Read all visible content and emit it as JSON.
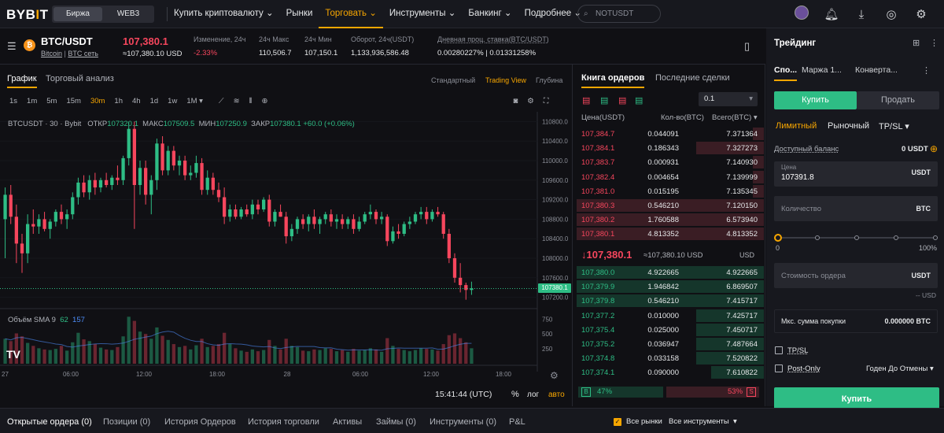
{
  "nav": {
    "logo_main": "BYB",
    "logo_accent": "I",
    "logo_end": "T",
    "seg_exchange": "Биржа",
    "seg_web3": "WEB3",
    "links": [
      "Купить криптовалюту",
      "Рынки",
      "Торговать",
      "Инструменты",
      "Банкинг",
      "Подробнее"
    ],
    "search_placeholder": "NOTUSDT"
  },
  "ticker": {
    "pair": "BTC/USDT",
    "sub_name": "Bitcoin",
    "sub_net": "BTC сеть",
    "price": "107,380.1",
    "price_usd": "≈107,380.10 USD",
    "change_label": "Изменение, 24ч",
    "change_value": "-2.33%",
    "high_label": "24ч Макс",
    "high_value": "110,506.7",
    "low_label": "24ч Мин",
    "low_value": "107,150.1",
    "turnover_label": "Оборот, 24ч(USDT)",
    "turnover_value": "1,133,936,586.48",
    "funding_label": "Дневная проц. ставка(BTC/USDT)",
    "funding_value": "0.00280227% | 0.01331258%"
  },
  "chart_tabs": {
    "chart": "График",
    "analysis": "Торговый анализ",
    "standard": "Стандартный",
    "tradingview": "Trading View",
    "depth": "Глубина"
  },
  "timeframes": [
    "1s",
    "1m",
    "5m",
    "15m",
    "30m",
    "1h",
    "4h",
    "1d",
    "1w",
    "1M ▾"
  ],
  "chart_legend": {
    "symbol": "BTCUSDT · 30 · Bybit",
    "open_label": "ОТКР",
    "open": "107320.1",
    "high_label": "МАКС",
    "high": "107509.5",
    "low_label": "МИН",
    "low": "107250.9",
    "close_label": "ЗАКР",
    "close": "107380.1",
    "change": "+60.0 (+0.06%)",
    "volume": "Объём SMA 9",
    "vol1": "62",
    "vol2": "157",
    "price_tag": "107380.1",
    "clock": "15:41:44 (UTC)",
    "pct": "%",
    "log": "лог",
    "auto": "авто"
  },
  "chart_data": {
    "type": "candlestick",
    "interval": "30m",
    "y_ticks": [
      110800,
      110400,
      110000,
      109600,
      109200,
      108800,
      108400,
      108000,
      107600,
      107200
    ],
    "vol_ticks": [
      750,
      500,
      250
    ],
    "x_ticks": [
      "06:00",
      "12:00",
      "18:00",
      "28",
      "06:00",
      "12:00",
      "18:00"
    ],
    "x_edge": "27",
    "candles": [
      [
        108800,
        109450,
        108000,
        109300,
        420
      ],
      [
        109300,
        109500,
        108700,
        108850,
        380
      ],
      [
        108850,
        109100,
        107900,
        108300,
        510
      ],
      [
        108300,
        108500,
        107700,
        108100,
        460
      ],
      [
        108100,
        108900,
        107900,
        108700,
        350
      ],
      [
        108700,
        109000,
        108500,
        108650,
        300
      ],
      [
        108650,
        108900,
        108500,
        108800,
        260
      ],
      [
        108800,
        108950,
        108550,
        108600,
        240
      ],
      [
        108600,
        108800,
        108400,
        108750,
        230
      ],
      [
        108750,
        109000,
        108650,
        108950,
        250
      ],
      [
        108950,
        109100,
        108700,
        108800,
        300
      ],
      [
        108800,
        109000,
        108600,
        108900,
        220
      ],
      [
        108900,
        109350,
        108800,
        109250,
        360
      ],
      [
        109250,
        109650,
        109100,
        109550,
        520
      ],
      [
        109550,
        109700,
        109250,
        109350,
        410
      ],
      [
        109350,
        109700,
        109200,
        109600,
        380
      ],
      [
        109600,
        109750,
        109300,
        109450,
        330
      ],
      [
        109450,
        109650,
        109350,
        109600,
        270
      ],
      [
        109600,
        109750,
        109450,
        109500,
        240
      ],
      [
        109500,
        109700,
        109400,
        109650,
        230
      ],
      [
        109650,
        109900,
        109500,
        109600,
        280
      ],
      [
        109600,
        110100,
        109500,
        110050,
        460
      ],
      [
        110050,
        110800,
        109900,
        110650,
        790
      ],
      [
        110650,
        110800,
        108600,
        109500,
        720
      ],
      [
        109500,
        110000,
        109300,
        109850,
        540
      ],
      [
        109850,
        110000,
        109100,
        109300,
        500
      ],
      [
        109300,
        109700,
        108900,
        109600,
        420
      ],
      [
        109600,
        110450,
        109400,
        110350,
        610
      ],
      [
        110350,
        110500,
        109700,
        109800,
        470
      ],
      [
        109800,
        110300,
        109700,
        110200,
        400
      ],
      [
        110200,
        110300,
        109800,
        109900,
        330
      ],
      [
        109900,
        110100,
        109700,
        110000,
        280
      ],
      [
        110000,
        110100,
        109600,
        109700,
        300
      ],
      [
        109700,
        109900,
        109600,
        109750,
        240
      ],
      [
        109750,
        110100,
        109650,
        109950,
        310
      ],
      [
        109950,
        110050,
        109300,
        109400,
        420
      ],
      [
        109400,
        109800,
        109300,
        109650,
        280
      ],
      [
        109650,
        109750,
        109300,
        109400,
        300
      ],
      [
        109400,
        109550,
        109150,
        109250,
        330
      ],
      [
        109250,
        109450,
        108700,
        108850,
        520
      ],
      [
        108850,
        109100,
        108750,
        109000,
        330
      ],
      [
        109000,
        109100,
        108800,
        108850,
        260
      ],
      [
        108850,
        109050,
        108800,
        109000,
        220
      ],
      [
        109000,
        109100,
        108850,
        108900,
        200
      ],
      [
        108900,
        109200,
        108800,
        109100,
        240
      ],
      [
        109100,
        109200,
        108900,
        109000,
        210
      ],
      [
        109000,
        109250,
        108950,
        109200,
        230
      ],
      [
        109200,
        109300,
        108650,
        108750,
        400
      ],
      [
        108750,
        109000,
        108650,
        108950,
        300
      ],
      [
        108950,
        109100,
        108850,
        108850,
        240
      ],
      [
        108850,
        108950,
        108300,
        108450,
        420
      ],
      [
        108450,
        108700,
        108350,
        108600,
        300
      ],
      [
        108600,
        108850,
        108500,
        108800,
        280
      ],
      [
        108800,
        108900,
        108600,
        108700,
        220
      ],
      [
        108700,
        108900,
        108550,
        108850,
        210
      ],
      [
        108850,
        109000,
        108600,
        108700,
        240
      ],
      [
        108700,
        108850,
        108500,
        108800,
        230
      ],
      [
        108800,
        108950,
        108700,
        108900,
        260
      ],
      [
        108900,
        109000,
        108650,
        108750,
        250
      ],
      [
        108750,
        108900,
        108600,
        108800,
        210
      ],
      [
        108800,
        108900,
        108600,
        108700,
        230
      ],
      [
        108700,
        108850,
        108600,
        108800,
        200
      ],
      [
        108800,
        108900,
        108500,
        108600,
        250
      ],
      [
        108600,
        108850,
        108550,
        108750,
        220
      ],
      [
        108750,
        108950,
        108700,
        108900,
        230
      ],
      [
        108900,
        109100,
        108800,
        108950,
        260
      ],
      [
        108950,
        109000,
        108700,
        108800,
        240
      ],
      [
        108800,
        108950,
        108700,
        108850,
        200
      ],
      [
        108850,
        108900,
        108250,
        108350,
        430
      ],
      [
        108350,
        108650,
        108300,
        108550,
        300
      ],
      [
        108550,
        108700,
        108400,
        108500,
        250
      ],
      [
        108500,
        108750,
        108450,
        108700,
        230
      ],
      [
        108700,
        108850,
        108600,
        108750,
        210
      ],
      [
        108750,
        108950,
        108700,
        108900,
        230
      ],
      [
        108900,
        109050,
        108800,
        108950,
        260
      ],
      [
        108950,
        109050,
        108700,
        108800,
        250
      ],
      [
        108800,
        109000,
        108750,
        108950,
        240
      ],
      [
        108950,
        109050,
        108850,
        108900,
        220
      ],
      [
        108900,
        108950,
        108400,
        108500,
        330
      ],
      [
        108500,
        108600,
        107900,
        108000,
        480
      ],
      [
        108000,
        108100,
        107500,
        107600,
        510
      ],
      [
        107600,
        107900,
        107300,
        107450,
        430
      ],
      [
        107450,
        107500,
        107150,
        107350,
        360
      ],
      [
        107350,
        107520,
        107250,
        107380,
        260
      ]
    ]
  },
  "orderbook": {
    "tab_book": "Книга ордеров",
    "tab_trades": "Последние сделки",
    "precision": "0.1",
    "col_price": "Цена(USDT)",
    "col_qty": "Кол-во(BTC)",
    "col_total": "Всего(BTC)",
    "asks": [
      {
        "price": "107,384.7",
        "qty": "0.044091",
        "total": "7.371364",
        "depth": 0.06
      },
      {
        "price": "107,384.1",
        "qty": "0.186343",
        "total": "7.327273",
        "depth": 0.36
      },
      {
        "price": "107,383.7",
        "qty": "0.000931",
        "total": "7.140930",
        "depth": 0.06
      },
      {
        "price": "107,382.4",
        "qty": "0.004654",
        "total": "7.139999",
        "depth": 0.06
      },
      {
        "price": "107,381.0",
        "qty": "0.015195",
        "total": "7.135345",
        "depth": 0.06
      },
      {
        "price": "107,380.3",
        "qty": "0.546210",
        "total": "7.120150",
        "depth": 1.0
      },
      {
        "price": "107,380.2",
        "qty": "1.760588",
        "total": "6.573940",
        "depth": 1.0
      },
      {
        "price": "107,380.1",
        "qty": "4.813352",
        "total": "4.813352",
        "depth": 1.0
      }
    ],
    "mid_price": "↓107,380.1",
    "mid_usd": "≈107,380.10 USD",
    "bids": [
      {
        "price": "107,380.0",
        "qty": "4.922665",
        "total": "4.922665",
        "depth": 1.0
      },
      {
        "price": "107,379.9",
        "qty": "1.946842",
        "total": "6.869507",
        "depth": 1.0
      },
      {
        "price": "107,379.8",
        "qty": "0.546210",
        "total": "7.415717",
        "depth": 1.0
      },
      {
        "price": "107,377.2",
        "qty": "0.010000",
        "total": "7.425717",
        "depth": 0.36
      },
      {
        "price": "107,375.4",
        "qty": "0.025000",
        "total": "7.450717",
        "depth": 0.36
      },
      {
        "price": "107,375.2",
        "qty": "0.036947",
        "total": "7.487664",
        "depth": 0.36
      },
      {
        "price": "107,374.8",
        "qty": "0.033158",
        "total": "7.520822",
        "depth": 0.36
      },
      {
        "price": "107,374.1",
        "qty": "0.090000",
        "total": "7.610822",
        "depth": 0.28
      }
    ],
    "buy_pct": "47%",
    "sell_pct": "53%",
    "buy_badge": "B",
    "sell_badge": "S"
  },
  "trade": {
    "title": "Трейдинг",
    "tabs": [
      "Спо...",
      "Маржа 1...",
      "Конверта..."
    ],
    "buy": "Купить",
    "sell": "Продать",
    "order_types": [
      "Лимитный",
      "Рыночный",
      "TP/SL ▾"
    ],
    "avail_label": "Доступный баланс",
    "avail_value": "0 USDT",
    "price_label": "Цена",
    "price_value": "107391.8",
    "unit": "USDT",
    "qty_label": "Количество",
    "qty_unit": "BTC",
    "slider_min": "0",
    "slider_max": "100%",
    "order_value_label": "Стоимость ордера",
    "order_value_unit": "USDT",
    "order_value_hint": "-- USD",
    "max_buy_label": "Мкс. сумма покупки",
    "max_buy_value": "0.000000 BTC",
    "tpsl": "TP/SL",
    "post_only": "Post-Only",
    "tif": "Годен До Отмены ▾",
    "submit": "Купить"
  },
  "bottom": {
    "tabs": [
      "Открытые ордера (0)",
      "Позиции (0)",
      "История Ордеров",
      "История торговли",
      "Активы",
      "Займы (0)",
      "Инструменты (0)",
      "P&L"
    ],
    "all_markets": "Все рынки",
    "all_instruments": "Все инструменты"
  },
  "colors": {
    "up": "#2ebd85",
    "down": "#f6465d",
    "accent": "#f7a600"
  }
}
